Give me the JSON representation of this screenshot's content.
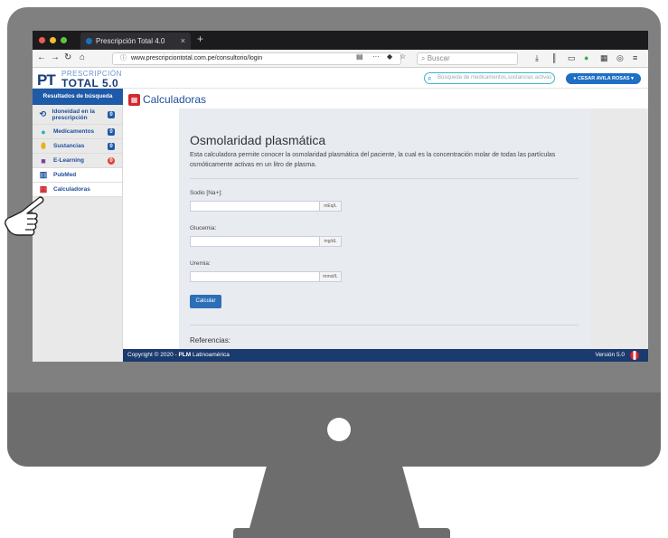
{
  "browser": {
    "tab_title": "Prescripción Total 4.0",
    "tab_close": "×",
    "new_tab": "+",
    "url": "www.prescripciontotal.com.pe/consultorio/login",
    "search_placeholder": "Buscar"
  },
  "site": {
    "logo_mark": "PT",
    "logo_top": "PRESCRIPCIÓN",
    "logo_bottom": "TOTAL 5.0",
    "search_placeholder": "Búsqueda de medicamentos,sustancias activas",
    "user_name": "CESAR AVILA ROSAS"
  },
  "sidebar": {
    "header": "Resultados de búsqueda",
    "items": [
      {
        "label": "Idoneidad en la prescripción",
        "badge": "0"
      },
      {
        "label": "Medicamentos",
        "badge": "0"
      },
      {
        "label": "Sustancias",
        "badge": "0"
      },
      {
        "label": "E-Learning",
        "badge": "0"
      },
      {
        "label": "PubMed"
      },
      {
        "label": "Calculadoras"
      }
    ]
  },
  "page": {
    "title": "Calculadoras"
  },
  "calculator": {
    "title": "Osmolaridad plasmática",
    "description": "Esta calculadora permite conocer la osmolaridad plasmática del paciente, la cual es la concentración molar de todas las partículas osmóticamente activas en un litro de plasma.",
    "fields": [
      {
        "label": "Sodio [Na+]:",
        "unit": "mEq/L",
        "value": ""
      },
      {
        "label": "Glucemia:",
        "unit": "mg/dL",
        "value": ""
      },
      {
        "label": "Uremia:",
        "unit": "mmol/L",
        "value": ""
      }
    ],
    "button_label": "Calcular",
    "references_label": "Referencias:"
  },
  "footer": {
    "copyright_prefix": "Copyright © 2020 - ",
    "brand": "PLM",
    "copyright_suffix": " Latinoamérica",
    "version": "Versión 5.0"
  },
  "colors": {
    "accent": "#1e5aa8",
    "footer": "#1b3a6e",
    "calculator_icon": "#d1272e",
    "monitor": "#808080"
  }
}
